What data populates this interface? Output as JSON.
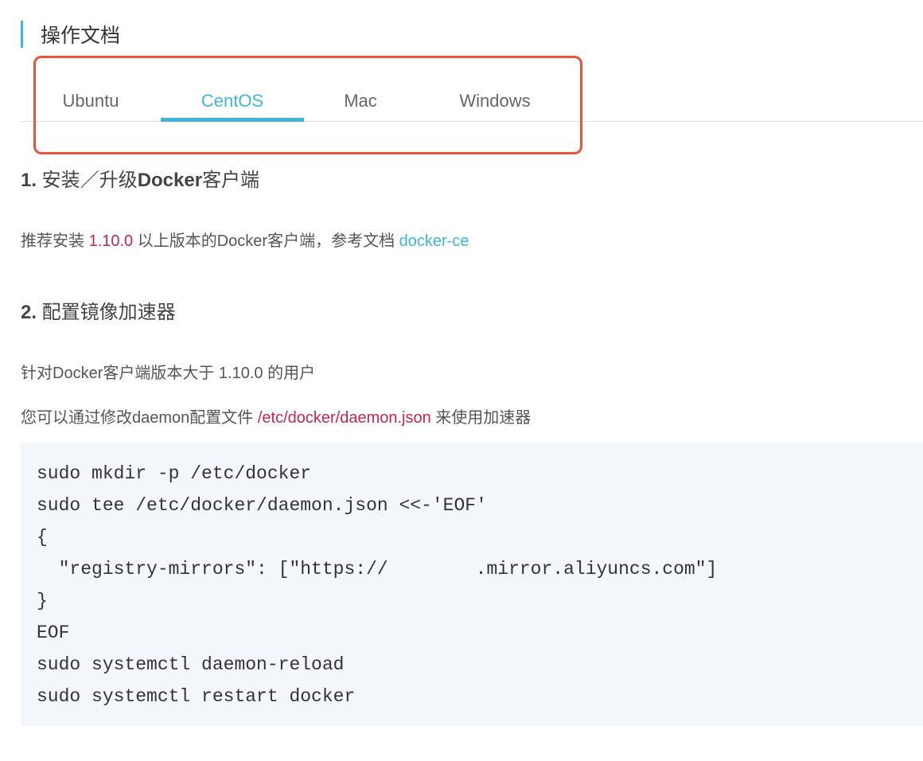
{
  "header": {
    "title": "操作文档"
  },
  "tabs": [
    {
      "label": "Ubuntu",
      "active": false
    },
    {
      "label": "CentOS",
      "active": true
    },
    {
      "label": "Mac",
      "active": false
    },
    {
      "label": "Windows",
      "active": false
    }
  ],
  "colors": {
    "accent": "#3fb6d8",
    "highlight_border": "#e8553a",
    "code_red": "#c7254e",
    "code_bg": "#f3f7fb"
  },
  "section1": {
    "num": "1.",
    "title_pre": " 安装／升级",
    "title_bold": "Docker",
    "title_post": "客户端",
    "text_pre": "推荐安装 ",
    "version": "1.10.0",
    "text_mid": " 以上版本的Docker客户端，参考文档 ",
    "link": "docker-ce"
  },
  "section2": {
    "num": "2.",
    "title": " 配置镜像加速器",
    "line1": "针对Docker客户端版本大于 1.10.0 的用户",
    "line2_pre": "您可以通过修改daemon配置文件 ",
    "path": "/etc/docker/daemon.json",
    "line2_post": " 来使用加速器"
  },
  "code": {
    "lines": [
      "sudo mkdir -p /etc/docker",
      "sudo tee /etc/docker/daemon.json <<-'EOF'",
      "{",
      "  \"registry-mirrors\": [\"https://",
      "}",
      "EOF",
      "sudo systemctl daemon-reload",
      "sudo systemctl restart docker"
    ],
    "mirror_suffix": ".mirror.aliyuncs.com\"]"
  }
}
